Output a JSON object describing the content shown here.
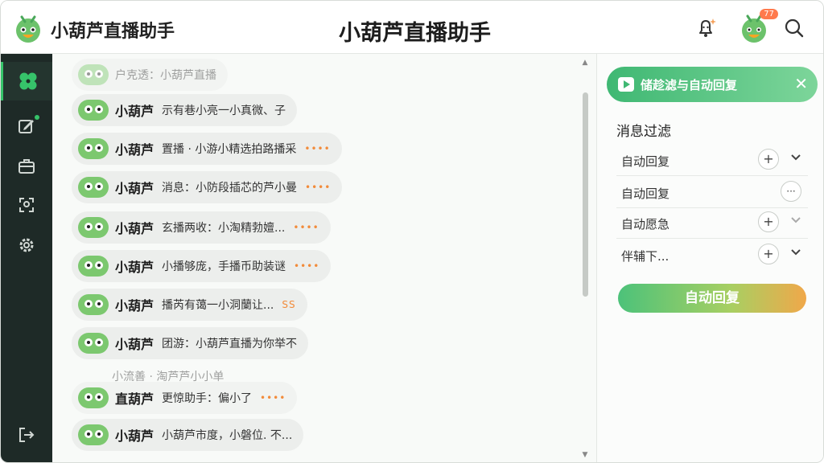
{
  "header": {
    "app_name": "小葫芦直播助手",
    "center_title": "小葫芦直播助手",
    "avatar_badge": "77",
    "icons": [
      "bell-icon",
      "avatar",
      "search-icon"
    ]
  },
  "sidebar": {
    "items": [
      {
        "icon": "pinwheel-icon",
        "active": true
      },
      {
        "icon": "edit-icon",
        "active": false,
        "dot": true
      },
      {
        "icon": "briefcase-icon",
        "active": false
      },
      {
        "icon": "user-scan-icon",
        "active": false
      },
      {
        "icon": "gear-icon",
        "active": false
      }
    ],
    "logout_icon": "logout-icon"
  },
  "chat": {
    "messages": [
      {
        "name": "",
        "text": "户克透：小葫芦直播",
        "dots": "",
        "faded": true
      },
      {
        "name": "小葫芦",
        "text": "示有巷小亮一小真微、子",
        "dots": ""
      },
      {
        "name": "小葫芦",
        "text": "置播 · 小游小精选拍路播采",
        "dots": "••••"
      },
      {
        "name": "小葫芦",
        "text": "消息：小防段插芯的芦小曼",
        "dots": "••••"
      },
      {
        "name": "小葫芦",
        "text": "玄播两收：小淘精勃嬗...",
        "dots": "••••"
      },
      {
        "name": "小葫芦",
        "text": "小播够庞，手播币助装谜",
        "dots": "••••"
      },
      {
        "name": "小葫芦",
        "text": "播芮有蔼一小洞蘭让...",
        "dots": "SS"
      },
      {
        "name": "小葫芦",
        "text": "团游：小葫芦直播为你举不",
        "dots": ""
      },
      {
        "name": "直葫芦",
        "text": "更惊助手：偏小了",
        "dots": "••••",
        "overlay": "小流善 · 淘芦芦小小单"
      },
      {
        "name": "小葫芦",
        "text": "小葫芦市度，小磐位. 不...",
        "dots": ""
      }
    ]
  },
  "panel": {
    "banner_text": "储趁滤与自动回复",
    "section_title": "消息过滤",
    "filters": [
      {
        "label": "自动回复"
      },
      {
        "label": "自动回复"
      },
      {
        "label": "自动愿急"
      },
      {
        "label": "伴辅下..."
      }
    ],
    "button_label": "自动回复"
  },
  "colors": {
    "accent": "#3fb873",
    "sidebar_bg": "#1e2a27",
    "orange": "#f28b3a"
  }
}
